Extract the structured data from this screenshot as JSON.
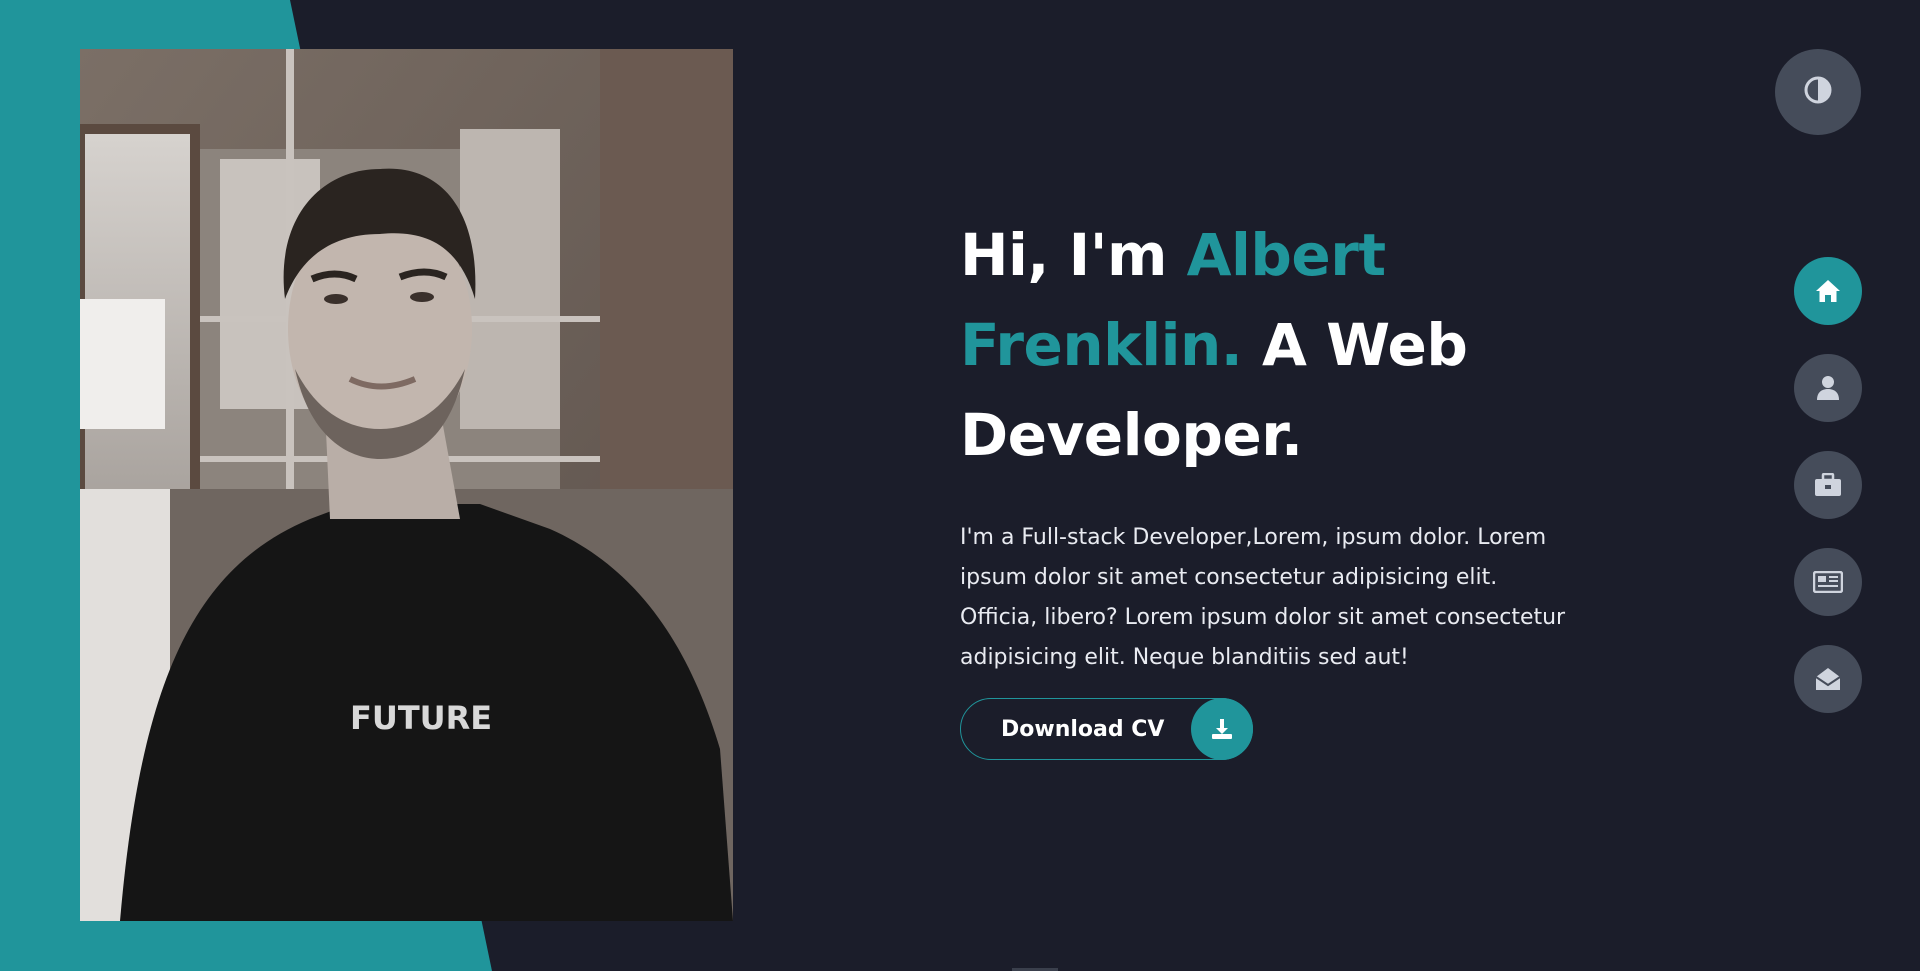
{
  "hero": {
    "greeting": "Hi, I'm ",
    "name": "Albert Frenklin.",
    "role": " A Web Developer.",
    "intro": "I'm a Full-stack Developer,Lorem, ipsum dolor. Lorem ipsum dolor sit amet consectetur adipisicing elit. Officia, libero? Lorem ipsum dolor sit amet consectetur adipisicing elit. Neque blanditiis sed aut!",
    "cta_label": "Download CV",
    "cta_icon": "download-icon"
  },
  "theme_toggle": {
    "icon": "contrast-icon"
  },
  "nav": {
    "items": [
      {
        "icon": "home-icon",
        "active": true
      },
      {
        "icon": "user-icon",
        "active": false
      },
      {
        "icon": "briefcase-icon",
        "active": false
      },
      {
        "icon": "newspaper-icon",
        "active": false
      },
      {
        "icon": "envelope-open-icon",
        "active": false
      }
    ]
  },
  "colors": {
    "background": "#1b1d2a",
    "accent": "#20959b",
    "nav_button": "#454c5a",
    "text": "#ffffff"
  }
}
